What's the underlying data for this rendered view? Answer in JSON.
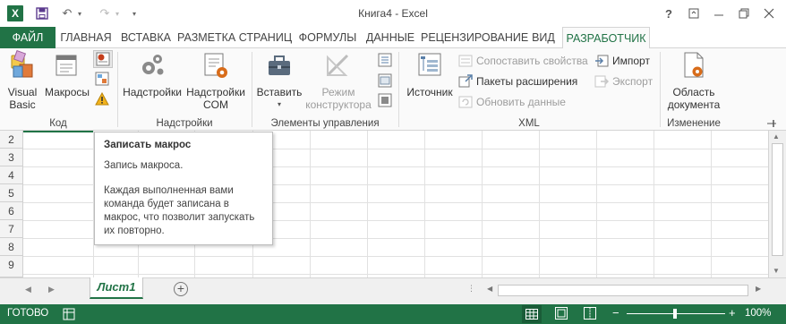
{
  "window": {
    "title": "Книга4 - Excel",
    "help_label": "?"
  },
  "tabs": [
    {
      "label": "ФАЙЛ"
    },
    {
      "label": "ГЛАВНАЯ"
    },
    {
      "label": "ВСТАВКА"
    },
    {
      "label": "РАЗМЕТКА СТРАНИЦ"
    },
    {
      "label": "ФОРМУЛЫ"
    },
    {
      "label": "ДАННЫЕ"
    },
    {
      "label": "РЕЦЕНЗИРОВАНИЕ"
    },
    {
      "label": "ВИД"
    },
    {
      "label": "РАЗРАБОТЧИК"
    }
  ],
  "ribbon": {
    "code": {
      "label": "Код",
      "visual_basic_1": "Visual",
      "visual_basic_2": "Basic",
      "macros": "Макросы"
    },
    "addins": {
      "label": "Надстройки",
      "addins": "Надстройки",
      "com_1": "Надстройки",
      "com_2": "COM"
    },
    "controls": {
      "label": "Элементы управления",
      "insert": "Вставить",
      "design_mode_1": "Режим",
      "design_mode_2": "конструктора"
    },
    "xml": {
      "label": "XML",
      "source": "Источник",
      "map_properties": "Сопоставить свойства",
      "expansion_packs": "Пакеты расширения",
      "refresh_data": "Обновить данные",
      "import": "Импорт",
      "export": "Экспорт"
    },
    "modify": {
      "label": "Изменение",
      "doc_panel_1": "Область",
      "doc_panel_2": "документа"
    }
  },
  "grid": {
    "row_numbers": [
      "2",
      "3",
      "4",
      "5",
      "6",
      "7",
      "8",
      "9"
    ]
  },
  "tooltip": {
    "title": "Записать макрос",
    "line1": "Запись макроса.",
    "line2": "Каждая выполненная вами команда будет записана в макрос, что позволит запускать их повторно."
  },
  "sheets": {
    "active": "Лист1",
    "add_label": "+"
  },
  "status": {
    "ready": "ГОТОВО",
    "zoom": "100%",
    "zoom_level_percent": 100
  },
  "colors": {
    "accent": "#217346",
    "orange": "#d86c1a",
    "red": "#c43e1c"
  }
}
